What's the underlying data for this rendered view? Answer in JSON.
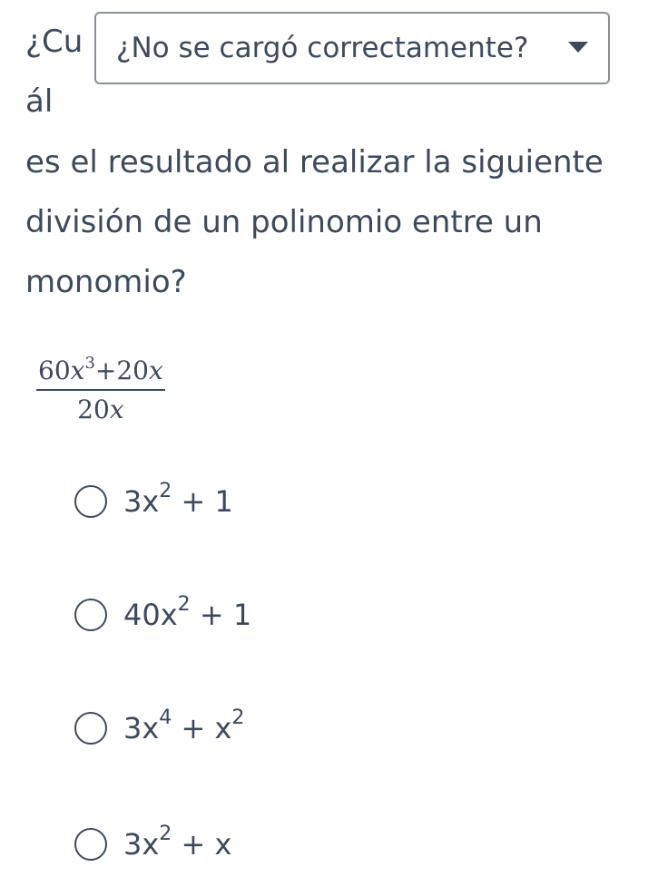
{
  "question": {
    "prefix_line1": "¿Cu",
    "prefix_line2": "ál",
    "body": "es el resultado al realizar la siguiente división de un polinomio entre un monomio?"
  },
  "dropdown": {
    "label": "¿No se cargó correctamente?"
  },
  "expression": {
    "num_coef1": "60",
    "num_var1": "x",
    "num_exp1": "3",
    "num_op": "+",
    "num_coef2": "20",
    "num_var2": "x",
    "den_coef": "20",
    "den_var": "x"
  },
  "options": [
    {
      "base": "3x",
      "exp": "2",
      "rest": " + 1",
      "exp2": ""
    },
    {
      "base": "40x",
      "exp": "2",
      "rest": " + 1",
      "exp2": ""
    },
    {
      "base": "3x",
      "exp": "4",
      "rest": " + x",
      "exp2": "2"
    },
    {
      "base": "3x",
      "exp": "2",
      "rest": " + x",
      "exp2": ""
    }
  ]
}
